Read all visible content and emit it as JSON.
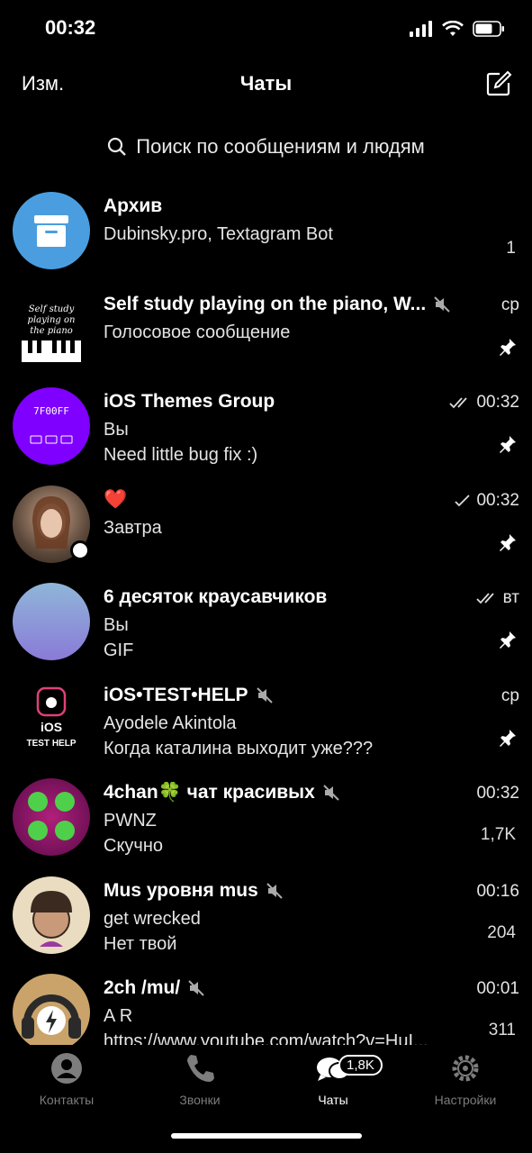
{
  "status": {
    "time": "00:32"
  },
  "nav": {
    "edit": "Изм.",
    "title": "Чаты"
  },
  "search": {
    "placeholder": "Поиск по сообщениям и людям"
  },
  "chats": [
    {
      "name": "Архив",
      "line1": "Dubinsky.pro, Textagram Bot",
      "line2": "",
      "time": "",
      "badge": "1"
    },
    {
      "name": "Self study playing on the piano, W...",
      "line1": "Голосовое сообщение",
      "line2": "",
      "time": "ср",
      "avatar_text": "Self study playing on the piano"
    },
    {
      "name": "iOS Themes Group",
      "line1": "Вы",
      "line2": "Need little bug fix :)",
      "time": "00:32",
      "avatar_text": "7F00FF"
    },
    {
      "name": "❤️",
      "line1": "Завтра",
      "line2": "",
      "time": "00:32"
    },
    {
      "name": "6 десяток краусавчиков",
      "line1": "Вы",
      "line2": "GIF",
      "time": "вт"
    },
    {
      "name": "iOS•TEST•HELP",
      "line1": "Ayodele Akintola",
      "line2": "Когда каталина выходит уже???",
      "time": "ср",
      "avatar_text": "iOS TEST HELP"
    },
    {
      "name": "4chan🍀 чат красивых",
      "line1": "PWNZ",
      "line2": "Скучно",
      "time": "00:32",
      "badge": "1,7K"
    },
    {
      "name": "Mus уровня mus",
      "line1": "get wrecked",
      "line2": "Нет твой",
      "time": "00:16",
      "badge": "204"
    },
    {
      "name": "2ch /mu/",
      "line1": "A R",
      "line2": "https://www.youtube.com/watch?v=HuI...",
      "time": "00:01",
      "badge": "311"
    }
  ],
  "tabs": {
    "contacts": "Контакты",
    "calls": "Звонки",
    "chats": "Чаты",
    "chats_badge": "1,8K",
    "settings": "Настройки"
  },
  "colors": {
    "accent": "#3478f6",
    "background": "#000000",
    "archive": "#4a9ee0",
    "purple": "#7f00ff"
  }
}
